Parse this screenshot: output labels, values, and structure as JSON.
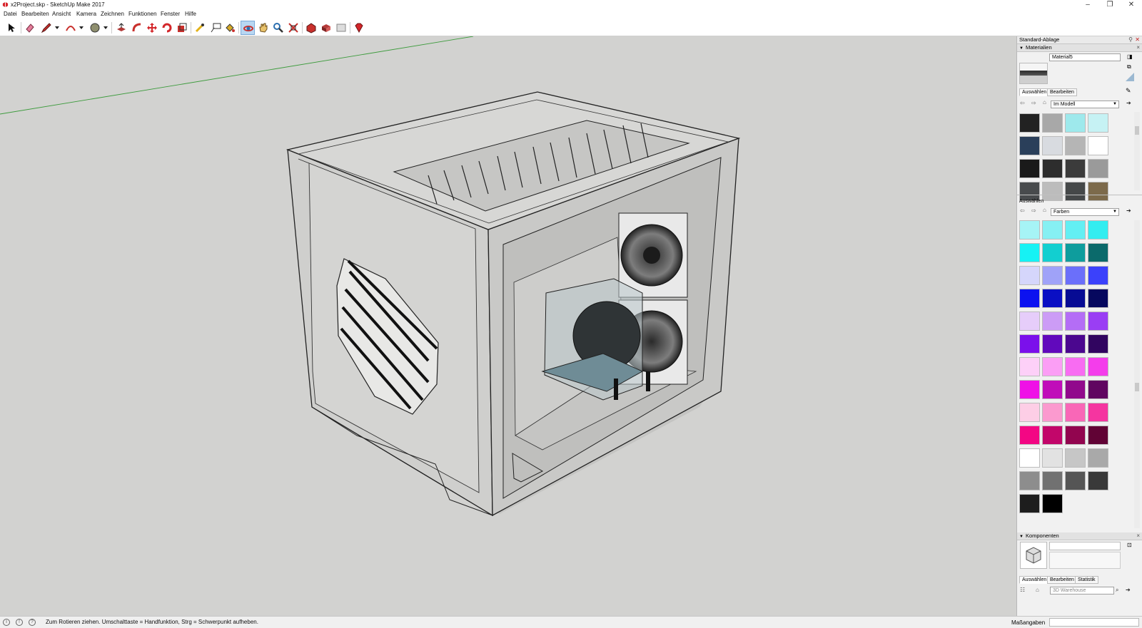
{
  "window": {
    "title": "x2Project.skp - SketchUp Make 2017",
    "controls": [
      "minimize",
      "maximize",
      "close"
    ]
  },
  "menu": [
    "Datei",
    "Bearbeiten",
    "Ansicht",
    "Kamera",
    "Zeichnen",
    "Funktionen",
    "Fenster",
    "Hilfe"
  ],
  "toolbar": {
    "tools": [
      "select",
      "eraser",
      "line",
      "arc",
      "circle",
      "push-pull",
      "follow-me",
      "move",
      "rotate",
      "scale",
      "tape-measure",
      "text",
      "paint-bucket",
      "orbit",
      "pan",
      "zoom",
      "zoom-extents",
      "warehouse",
      "extension-warehouse",
      "layout",
      "ruby-gem"
    ],
    "active_tool": "orbit"
  },
  "tray": {
    "title": "Standard-Ablage",
    "materials": {
      "header": "Materialien",
      "material_name": "Material5",
      "tabs": [
        "Auswählen",
        "Bearbeiten"
      ],
      "library_select": "Im Modell",
      "secondary_label": "Auswählen",
      "colors_select": "Farben",
      "model_swatches": [
        "#222222",
        "#a8a8a8",
        "#9ee9ec",
        "#c6f2f4",
        "#2a3f5a",
        "#d8dbe0",
        "#b5b5b5",
        "#ffffff",
        "#1a1a1a",
        "#2d2d2d",
        "#3b3b3b",
        "#9a9a9a",
        "#484b4d",
        "#bcbcbc",
        "#454849",
        "#7c6a4b"
      ],
      "color_swatches": [
        "#a6f4f6",
        "#86f0f3",
        "#63eff3",
        "#33edf0",
        "#16f2f4",
        "#12cfd0",
        "#0e9d9d",
        "#0b6a6b",
        "#d5d6fb",
        "#9fa2f8",
        "#6b6ffa",
        "#3b41fb",
        "#0c12f0",
        "#0a0fc4",
        "#070b94",
        "#06085e",
        "#e6cdfa",
        "#cc9cf6",
        "#b46df6",
        "#9a3ef4",
        "#7b10eb",
        "#6109bc",
        "#4b078f",
        "#310560",
        "#fdd0f8",
        "#fb9ef5",
        "#f86cf2",
        "#f43deb",
        "#ef11e6",
        "#c00db9",
        "#91098c",
        "#600660",
        "#fdcee6",
        "#fb9acf",
        "#f967b7",
        "#f535a0",
        "#f30784",
        "#c2066a",
        "#92054f",
        "#610335",
        "#ffffff",
        "#e2e2e2",
        "#c6c6c6",
        "#a9a9a9",
        "#8d8d8d",
        "#717171",
        "#555555",
        "#393939",
        "#1d1d1d",
        "#000000"
      ]
    },
    "components": {
      "header": "Komponenten",
      "tabs": [
        "Auswählen",
        "Bearbeiten",
        "Statistik"
      ],
      "search_placeholder": "3D Warehouse"
    }
  },
  "status": {
    "hint": "Zum Rotieren ziehen. Umschalttaste = Handfunktion, Strg = Schwerpunkt aufheben.",
    "measure_label": "Maßangaben",
    "measure_value": ""
  }
}
